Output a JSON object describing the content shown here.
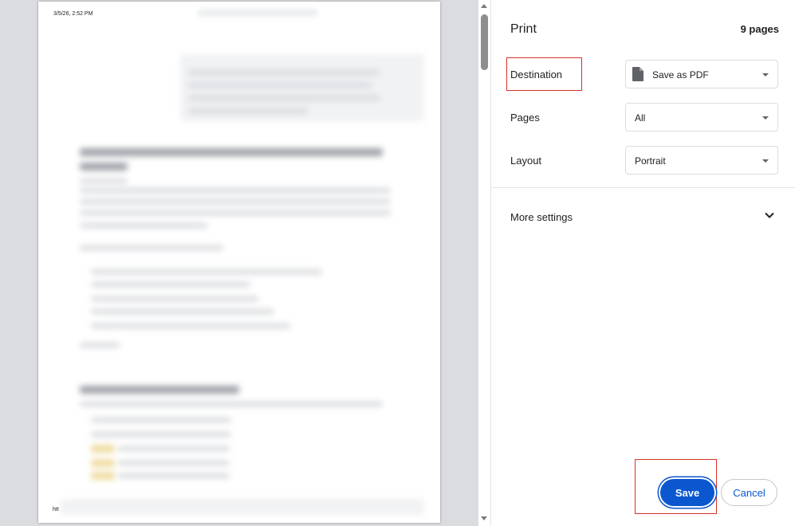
{
  "preview": {
    "header_timestamp": "3/5/26, 2:52 PM",
    "footer_url": "htt"
  },
  "panel": {
    "title": "Print",
    "page_count": "9 pages",
    "destination": {
      "label": "Destination",
      "value": "Save as PDF",
      "icon": "file-icon"
    },
    "pages": {
      "label": "Pages",
      "value": "All"
    },
    "layout": {
      "label": "Layout",
      "value": "Portrait"
    },
    "more_settings": {
      "label": "More settings",
      "icon": "chevron-down-icon"
    },
    "buttons": {
      "save": "Save",
      "cancel": "Cancel"
    }
  },
  "colors": {
    "accent": "#0b57d0",
    "highlight": "#d93025",
    "preview_background": "#dadce0"
  }
}
